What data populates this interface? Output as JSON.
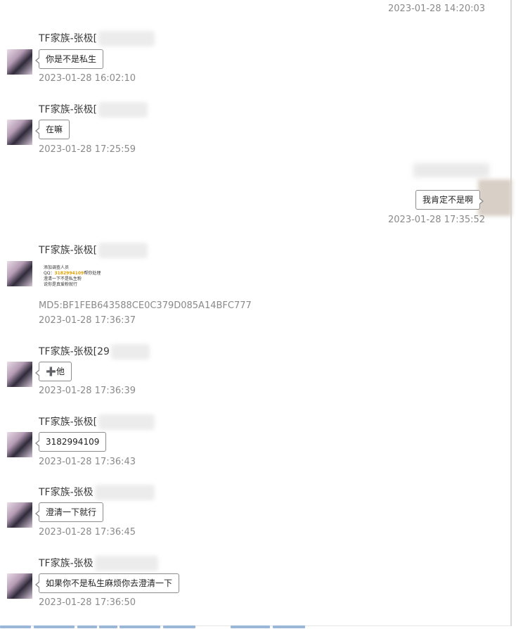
{
  "messages": [
    {
      "sender": "",
      "text": "",
      "time": "2023-01-28 14:20:03"
    },
    {
      "sender": "TF家族-张极[",
      "text": "你是不是私生",
      "time": "2023-01-28 16:02:10"
    },
    {
      "sender": "TF家族-张极[",
      "text": "在嘛",
      "time": "2023-01-28 17:25:59"
    },
    {
      "sender": "",
      "text": "我肯定不是啊",
      "time": "2023-01-28 17:35:52"
    },
    {
      "sender": "TF家族-张极[",
      "image_lines": [
        "添加调查人员",
        "QQ：",
        "3182994109",
        "帮你处理",
        "澄清一下不是私生粉",
        "说你是真爱粉就行"
      ],
      "md5": "MD5:BF1FEB643588CE0C379D085A14BFC777",
      "time": "2023-01-28 17:36:37"
    },
    {
      "sender": "TF家族-张极[",
      "sender_suffix": "29",
      "text": "➕他",
      "time": "2023-01-28 17:36:39"
    },
    {
      "sender": "TF家族-张极[",
      "text": "3182994109",
      "time": "2023-01-28 17:36:43"
    },
    {
      "sender": "TF家族-张极",
      "text": "澄清一下就行",
      "time": "2023-01-28 17:36:45"
    },
    {
      "sender": "TF家族-张极",
      "text": "如果你不是私生麻烦你去澄清一下",
      "time": "2023-01-28 17:36:50"
    }
  ]
}
